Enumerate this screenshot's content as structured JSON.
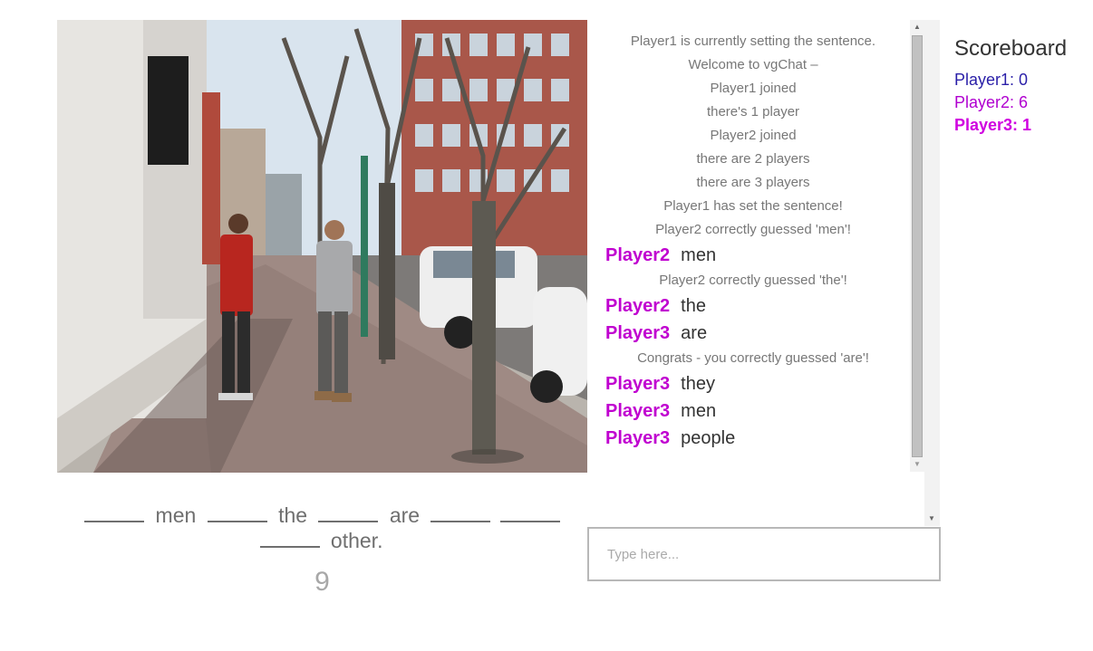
{
  "chat": {
    "messages": [
      {
        "kind": "system",
        "text": "Player1 is currently setting the sentence."
      },
      {
        "kind": "system",
        "text": "Welcome to vgChat –"
      },
      {
        "kind": "system",
        "text": "Player1 joined"
      },
      {
        "kind": "system",
        "text": "there's 1 player"
      },
      {
        "kind": "system",
        "text": "Player2 joined"
      },
      {
        "kind": "system",
        "text": "there are 2 players"
      },
      {
        "kind": "system",
        "text": "there are 3 players"
      },
      {
        "kind": "system",
        "text": "Player1 has set the sentence!"
      },
      {
        "kind": "system",
        "text": "Player2 correctly guessed 'men'!"
      },
      {
        "kind": "user",
        "player": "Player2",
        "text": "men"
      },
      {
        "kind": "system",
        "text": "Player2 correctly guessed 'the'!"
      },
      {
        "kind": "user",
        "player": "Player2",
        "text": "the"
      },
      {
        "kind": "user",
        "player": "Player3",
        "text": "are"
      },
      {
        "kind": "system",
        "text": "Congrats - you correctly guessed 'are'!"
      },
      {
        "kind": "user",
        "player": "Player3",
        "text": "they"
      },
      {
        "kind": "user",
        "player": "Player3",
        "text": "men"
      },
      {
        "kind": "user",
        "player": "Player3",
        "text": "people"
      }
    ],
    "input_placeholder": "Type here..."
  },
  "sentence": {
    "tokens": [
      {
        "type": "blank"
      },
      {
        "type": "word",
        "text": "men"
      },
      {
        "type": "blank"
      },
      {
        "type": "word",
        "text": "the"
      },
      {
        "type": "blank"
      },
      {
        "type": "word",
        "text": "are"
      },
      {
        "type": "blank"
      },
      {
        "type": "blank"
      },
      {
        "type": "blank"
      },
      {
        "type": "word",
        "text": "other."
      }
    ]
  },
  "timer": "9",
  "scoreboard": {
    "title": "Scoreboard",
    "players": [
      {
        "label": "Player1: 0",
        "color": "#2a1fa8",
        "bold": false
      },
      {
        "label": "Player2: 6",
        "color": "#b000d0",
        "bold": false
      },
      {
        "label": "Player3: 1",
        "color": "#d000e0",
        "bold": true
      }
    ]
  },
  "colors": {
    "player_name": "#c000d0"
  }
}
